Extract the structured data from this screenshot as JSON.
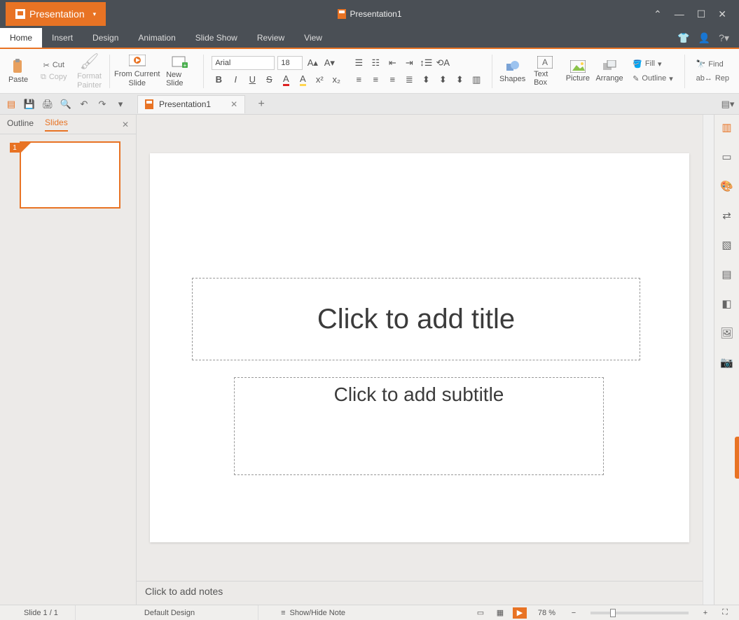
{
  "app": {
    "name": "Presentation",
    "document": "Presentation1"
  },
  "menu": {
    "tabs": [
      "Home",
      "Insert",
      "Design",
      "Animation",
      "Slide Show",
      "Review",
      "View"
    ],
    "active": 0
  },
  "ribbon": {
    "paste": "Paste",
    "cut": "Cut",
    "copy": "Copy",
    "format_painter": "Format\nPainter",
    "from_current": "From Current\nSlide",
    "new_slide": "New Slide",
    "font_name": "Arial",
    "font_size": "18",
    "shapes": "Shapes",
    "text_box": "Text Box",
    "picture": "Picture",
    "arrange": "Arrange",
    "fill": "Fill",
    "outline": "Outline",
    "find": "Find",
    "replace": "Rep"
  },
  "doctab": {
    "name": "Presentation1"
  },
  "leftpane": {
    "tabs": [
      "Outline",
      "Slides"
    ],
    "active": 1,
    "slide_number": "1"
  },
  "slide": {
    "title_placeholder": "Click to add title",
    "subtitle_placeholder": "Click to add subtitle"
  },
  "notes_placeholder": "Click to add notes",
  "status": {
    "slide_counter": "Slide 1 / 1",
    "design": "Default Design",
    "show_hide_note": "Show/Hide Note",
    "zoom": "78 %"
  }
}
